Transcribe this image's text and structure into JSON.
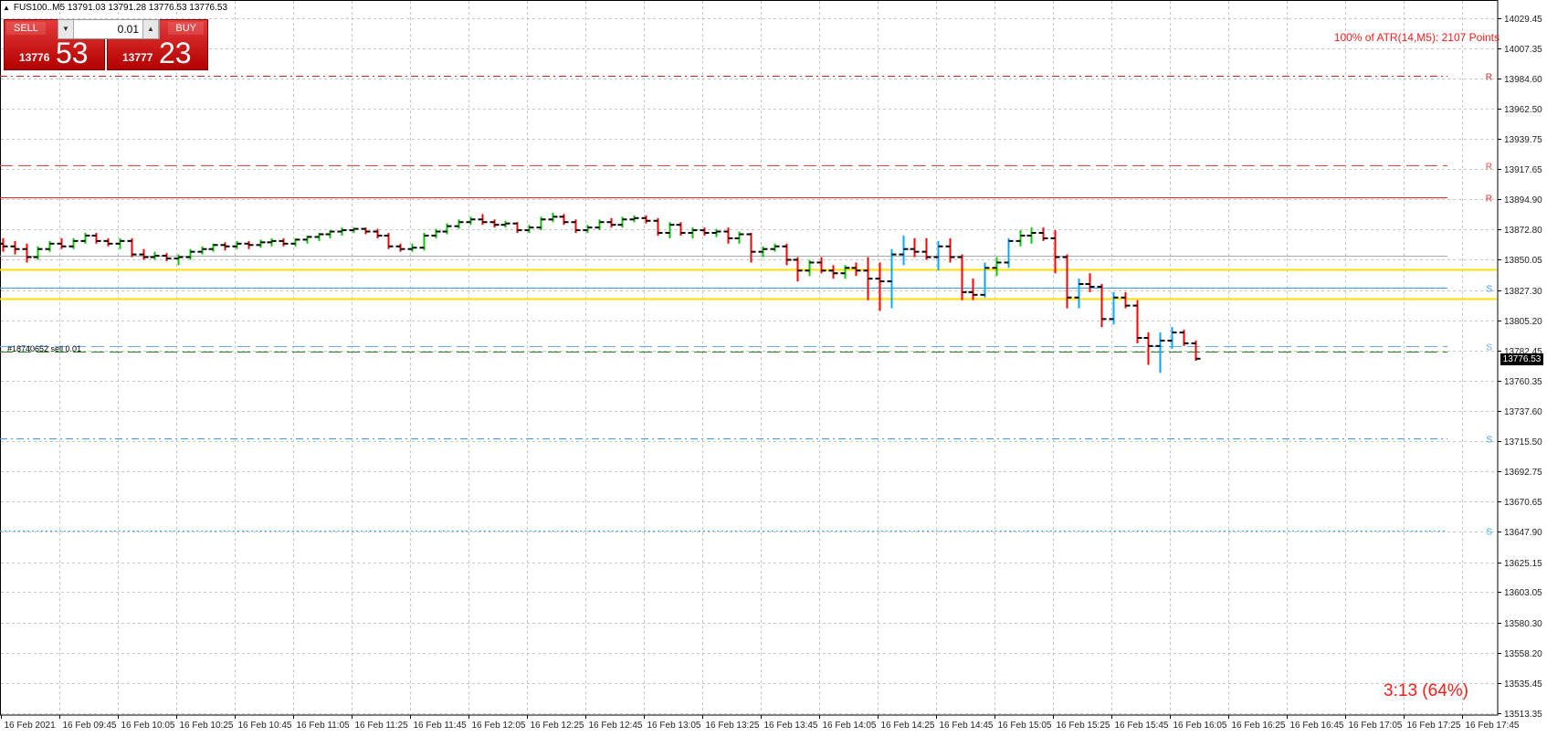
{
  "symbol_line": "FUS100..M5  13791.03 13791.28 13776.53 13776.53",
  "trade_panel": {
    "sell_label": "SELL",
    "buy_label": "BUY",
    "lot_value": "0.01",
    "sell_price_small": "13776",
    "sell_price_big": "53",
    "buy_price_small": "13777",
    "buy_price_big": "23"
  },
  "atr_text": "100% of ATR(14,M5): 2107  Points",
  "timer_text": "3:13 (64%)",
  "order_label": "#18740652 sell 0.01",
  "current_price_tag": "13776.53",
  "colors": {
    "bull": "#00cc00",
    "bull_strong": "#00aaff",
    "bear": "#ff0000",
    "resistance": "#e02020",
    "support": "#3399ff",
    "pivot_band": "#ffdd00",
    "grid": "#c8c8c8"
  },
  "chart_data": {
    "type": "bar",
    "title": "",
    "xlabel": "",
    "ylabel": "",
    "ylim": [
      13513.15,
      14029.45
    ],
    "grid": true,
    "y_ticks": [
      "14029.45",
      "14007.35",
      "13984.60",
      "13962.50",
      "13939.75",
      "13917.65",
      "13894.90",
      "13872.80",
      "13850.05",
      "13827.30",
      "13805.20",
      "13782.45",
      "13760.35",
      "13737.60",
      "13715.50",
      "13692.75",
      "13670.65",
      "13647.90",
      "13625.15",
      "13603.05",
      "13580.30",
      "13558.20",
      "13535.45",
      "13513.35"
    ],
    "x_ticks": [
      "16 Feb 2021",
      "16 Feb 09:45",
      "16 Feb 10:05",
      "16 Feb 10:25",
      "16 Feb 10:45",
      "16 Feb 11:05",
      "16 Feb 11:25",
      "16 Feb 11:45",
      "16 Feb 12:05",
      "16 Feb 12:25",
      "16 Feb 12:45",
      "16 Feb 13:05",
      "16 Feb 13:25",
      "16 Feb 13:45",
      "16 Feb 14:05",
      "16 Feb 14:25",
      "16 Feb 14:45",
      "16 Feb 15:05",
      "16 Feb 15:25",
      "16 Feb 15:45",
      "16 Feb 16:05",
      "16 Feb 16:25",
      "16 Feb 16:45",
      "16 Feb 17:05",
      "16 Feb 17:25",
      "16 Feb 17:45"
    ],
    "levels": [
      {
        "name": "R",
        "price": 13987.0,
        "style": "dashdot",
        "color": "#e02020",
        "label": "R"
      },
      {
        "name": "R",
        "price": 13920.0,
        "style": "dash",
        "color": "#ff4040",
        "label": "R"
      },
      {
        "name": "R",
        "price": 13896.5,
        "style": "solid",
        "color": "#ff2020",
        "label": "R"
      },
      {
        "name": "pivot-grey",
        "price": 13853.0,
        "style": "solid",
        "color": "#aaaaaa",
        "label": ""
      },
      {
        "name": "pivot-high",
        "price": 13843.0,
        "style": "solid",
        "color": "#ffdd00",
        "label": ""
      },
      {
        "name": "S",
        "price": 13829.0,
        "style": "solid",
        "color": "#3399ff",
        "label": "S"
      },
      {
        "name": "pivot-low",
        "price": 13821.0,
        "style": "solid",
        "color": "#ffdd00",
        "label": ""
      },
      {
        "name": "S",
        "price": 13786.0,
        "style": "dash",
        "color": "#66aaff",
        "label": "S"
      },
      {
        "name": "order",
        "price": 13781.5,
        "style": "dash",
        "color": "#228822",
        "label": ""
      },
      {
        "name": "S",
        "price": 13717.5,
        "style": "dashdot",
        "color": "#3399ff",
        "label": "S"
      },
      {
        "name": "S",
        "price": 13649.0,
        "style": "dot",
        "color": "#33aaff",
        "label": "S"
      }
    ],
    "bars": [
      {
        "o": 13862,
        "h": 13866,
        "l": 13856,
        "c": 13860
      },
      {
        "o": 13860,
        "h": 13864,
        "l": 13854,
        "c": 13858
      },
      {
        "o": 13858,
        "h": 13862,
        "l": 13848,
        "c": 13852
      },
      {
        "o": 13852,
        "h": 13860,
        "l": 13850,
        "c": 13858
      },
      {
        "o": 13858,
        "h": 13864,
        "l": 13856,
        "c": 13862
      },
      {
        "o": 13862,
        "h": 13866,
        "l": 13858,
        "c": 13860
      },
      {
        "o": 13860,
        "h": 13866,
        "l": 13858,
        "c": 13864
      },
      {
        "o": 13864,
        "h": 13870,
        "l": 13862,
        "c": 13868
      },
      {
        "o": 13868,
        "h": 13870,
        "l": 13862,
        "c": 13864
      },
      {
        "o": 13864,
        "h": 13866,
        "l": 13860,
        "c": 13862
      },
      {
        "o": 13862,
        "h": 13866,
        "l": 13858,
        "c": 13864
      },
      {
        "o": 13864,
        "h": 13866,
        "l": 13852,
        "c": 13854
      },
      {
        "o": 13854,
        "h": 13858,
        "l": 13850,
        "c": 13852
      },
      {
        "o": 13852,
        "h": 13856,
        "l": 13850,
        "c": 13853
      },
      {
        "o": 13853,
        "h": 13855,
        "l": 13849,
        "c": 13851
      },
      {
        "o": 13851,
        "h": 13854,
        "l": 13846,
        "c": 13852
      },
      {
        "o": 13852,
        "h": 13858,
        "l": 13850,
        "c": 13856
      },
      {
        "o": 13856,
        "h": 13860,
        "l": 13854,
        "c": 13858
      },
      {
        "o": 13858,
        "h": 13862,
        "l": 13856,
        "c": 13861
      },
      {
        "o": 13861,
        "h": 13863,
        "l": 13857,
        "c": 13860
      },
      {
        "o": 13860,
        "h": 13864,
        "l": 13858,
        "c": 13862
      },
      {
        "o": 13862,
        "h": 13864,
        "l": 13858,
        "c": 13861
      },
      {
        "o": 13861,
        "h": 13865,
        "l": 13859,
        "c": 13863
      },
      {
        "o": 13863,
        "h": 13866,
        "l": 13860,
        "c": 13864
      },
      {
        "o": 13864,
        "h": 13866,
        "l": 13860,
        "c": 13862
      },
      {
        "o": 13862,
        "h": 13866,
        "l": 13860,
        "c": 13865
      },
      {
        "o": 13865,
        "h": 13868,
        "l": 13862,
        "c": 13867
      },
      {
        "o": 13867,
        "h": 13870,
        "l": 13864,
        "c": 13869
      },
      {
        "o": 13869,
        "h": 13872,
        "l": 13866,
        "c": 13871
      },
      {
        "o": 13871,
        "h": 13874,
        "l": 13868,
        "c": 13872
      },
      {
        "o": 13872,
        "h": 13874,
        "l": 13870,
        "c": 13873
      },
      {
        "o": 13873,
        "h": 13874,
        "l": 13869,
        "c": 13871
      },
      {
        "o": 13871,
        "h": 13873,
        "l": 13866,
        "c": 13868
      },
      {
        "o": 13868,
        "h": 13870,
        "l": 13858,
        "c": 13860
      },
      {
        "o": 13860,
        "h": 13862,
        "l": 13856,
        "c": 13858
      },
      {
        "o": 13858,
        "h": 13862,
        "l": 13856,
        "c": 13859
      },
      {
        "o": 13859,
        "h": 13870,
        "l": 13857,
        "c": 13868
      },
      {
        "o": 13868,
        "h": 13873,
        "l": 13866,
        "c": 13871
      },
      {
        "o": 13871,
        "h": 13877,
        "l": 13869,
        "c": 13875
      },
      {
        "o": 13875,
        "h": 13880,
        "l": 13873,
        "c": 13878
      },
      {
        "o": 13878,
        "h": 13882,
        "l": 13876,
        "c": 13880
      },
      {
        "o": 13880,
        "h": 13884,
        "l": 13876,
        "c": 13878
      },
      {
        "o": 13878,
        "h": 13880,
        "l": 13874,
        "c": 13876
      },
      {
        "o": 13876,
        "h": 13879,
        "l": 13874,
        "c": 13877
      },
      {
        "o": 13877,
        "h": 13878,
        "l": 13870,
        "c": 13872
      },
      {
        "o": 13872,
        "h": 13876,
        "l": 13870,
        "c": 13874
      },
      {
        "o": 13874,
        "h": 13882,
        "l": 13872,
        "c": 13880
      },
      {
        "o": 13880,
        "h": 13885,
        "l": 13878,
        "c": 13882
      },
      {
        "o": 13882,
        "h": 13884,
        "l": 13876,
        "c": 13878
      },
      {
        "o": 13878,
        "h": 13880,
        "l": 13870,
        "c": 13872
      },
      {
        "o": 13872,
        "h": 13876,
        "l": 13870,
        "c": 13874
      },
      {
        "o": 13874,
        "h": 13880,
        "l": 13872,
        "c": 13878
      },
      {
        "o": 13878,
        "h": 13881,
        "l": 13874,
        "c": 13876
      },
      {
        "o": 13876,
        "h": 13882,
        "l": 13874,
        "c": 13880
      },
      {
        "o": 13880,
        "h": 13883,
        "l": 13878,
        "c": 13881
      },
      {
        "o": 13881,
        "h": 13883,
        "l": 13877,
        "c": 13879
      },
      {
        "o": 13879,
        "h": 13881,
        "l": 13868,
        "c": 13870
      },
      {
        "o": 13870,
        "h": 13878,
        "l": 13866,
        "c": 13876
      },
      {
        "o": 13876,
        "h": 13878,
        "l": 13868,
        "c": 13870
      },
      {
        "o": 13870,
        "h": 13874,
        "l": 13866,
        "c": 13872
      },
      {
        "o": 13872,
        "h": 13874,
        "l": 13868,
        "c": 13870
      },
      {
        "o": 13870,
        "h": 13873,
        "l": 13867,
        "c": 13871
      },
      {
        "o": 13871,
        "h": 13874,
        "l": 13862,
        "c": 13866
      },
      {
        "o": 13866,
        "h": 13871,
        "l": 13862,
        "c": 13869
      },
      {
        "o": 13869,
        "h": 13870,
        "l": 13848,
        "c": 13856
      },
      {
        "o": 13856,
        "h": 13860,
        "l": 13852,
        "c": 13858
      },
      {
        "o": 13858,
        "h": 13862,
        "l": 13856,
        "c": 13860
      },
      {
        "o": 13860,
        "h": 13862,
        "l": 13846,
        "c": 13850
      },
      {
        "o": 13850,
        "h": 13852,
        "l": 13834,
        "c": 13842
      },
      {
        "o": 13842,
        "h": 13850,
        "l": 13838,
        "c": 13848
      },
      {
        "o": 13848,
        "h": 13852,
        "l": 13840,
        "c": 13842
      },
      {
        "o": 13842,
        "h": 13846,
        "l": 13836,
        "c": 13840
      },
      {
        "o": 13840,
        "h": 13846,
        "l": 13836,
        "c": 13844
      },
      {
        "o": 13844,
        "h": 13848,
        "l": 13838,
        "c": 13842
      },
      {
        "o": 13842,
        "h": 13852,
        "l": 13820,
        "c": 13836
      },
      {
        "o": 13836,
        "h": 13848,
        "l": 13812,
        "c": 13834
      },
      {
        "o": 13834,
        "h": 13858,
        "l": 13814,
        "c": 13854
      },
      {
        "o": 13854,
        "h": 13868,
        "l": 13846,
        "c": 13858
      },
      {
        "o": 13858,
        "h": 13866,
        "l": 13852,
        "c": 13856
      },
      {
        "o": 13856,
        "h": 13866,
        "l": 13850,
        "c": 13852
      },
      {
        "o": 13852,
        "h": 13864,
        "l": 13842,
        "c": 13860
      },
      {
        "o": 13860,
        "h": 13866,
        "l": 13848,
        "c": 13852
      },
      {
        "o": 13852,
        "h": 13854,
        "l": 13820,
        "c": 13826
      },
      {
        "o": 13826,
        "h": 13836,
        "l": 13820,
        "c": 13824
      },
      {
        "o": 13824,
        "h": 13848,
        "l": 13822,
        "c": 13844
      },
      {
        "o": 13844,
        "h": 13852,
        "l": 13838,
        "c": 13848
      },
      {
        "o": 13848,
        "h": 13866,
        "l": 13844,
        "c": 13864
      },
      {
        "o": 13864,
        "h": 13872,
        "l": 13860,
        "c": 13868
      },
      {
        "o": 13868,
        "h": 13874,
        "l": 13862,
        "c": 13870
      },
      {
        "o": 13870,
        "h": 13874,
        "l": 13864,
        "c": 13866
      },
      {
        "o": 13866,
        "h": 13872,
        "l": 13840,
        "c": 13852
      },
      {
        "o": 13852,
        "h": 13854,
        "l": 13814,
        "c": 13822
      },
      {
        "o": 13822,
        "h": 13836,
        "l": 13814,
        "c": 13832
      },
      {
        "o": 13832,
        "h": 13840,
        "l": 13826,
        "c": 13830
      },
      {
        "o": 13830,
        "h": 13832,
        "l": 13800,
        "c": 13806
      },
      {
        "o": 13806,
        "h": 13826,
        "l": 13802,
        "c": 13822
      },
      {
        "o": 13822,
        "h": 13826,
        "l": 13814,
        "c": 13816
      },
      {
        "o": 13816,
        "h": 13820,
        "l": 13788,
        "c": 13792
      },
      {
        "o": 13792,
        "h": 13796,
        "l": 13772,
        "c": 13786
      },
      {
        "o": 13786,
        "h": 13796,
        "l": 13766,
        "c": 13790
      },
      {
        "o": 13790,
        "h": 13800,
        "l": 13784,
        "c": 13796
      },
      {
        "o": 13796,
        "h": 13798,
        "l": 13786,
        "c": 13788
      },
      {
        "o": 13788,
        "h": 13790,
        "l": 13775,
        "c": 13776.53
      }
    ]
  }
}
